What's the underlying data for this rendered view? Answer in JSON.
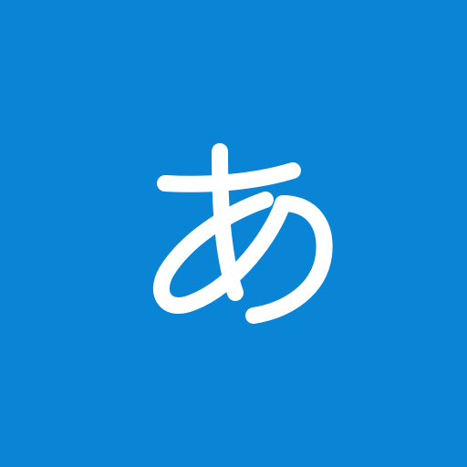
{
  "tile": {
    "background_color": "#0A84D4",
    "glyph": {
      "character": "あ",
      "color": "#FFFFFF",
      "icon_name": "hiragana-a-icon"
    }
  }
}
